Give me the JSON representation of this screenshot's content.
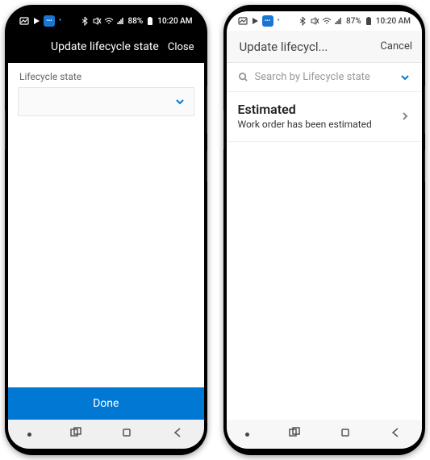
{
  "phone1": {
    "status": {
      "battery": "88%",
      "time": "10:20 AM"
    },
    "appbar": {
      "title": "Update lifecycle state",
      "close": "Close"
    },
    "form": {
      "lifecycle_label": "Lifecycle state"
    },
    "primary_button": "Done"
  },
  "phone2": {
    "status": {
      "battery": "87%",
      "time": "10:20 AM"
    },
    "appbar": {
      "title": "Update lifecycl...",
      "close": "Cancel"
    },
    "search": {
      "placeholder": "Search by Lifecycle state"
    },
    "options": [
      {
        "name": "Estimated",
        "desc": "Work order has been estimated"
      }
    ]
  }
}
